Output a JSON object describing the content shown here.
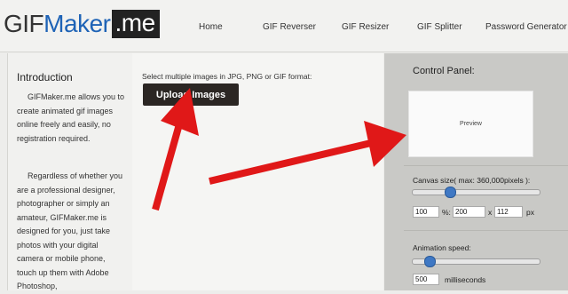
{
  "logo": {
    "part1": "GIF",
    "part2": "Maker",
    "part3": ".me"
  },
  "nav": [
    "Home",
    "GIF Reverser",
    "GIF Resizer",
    "GIF Splitter",
    "Password Generator"
  ],
  "intro": {
    "title": "Introduction",
    "p1": "GIFMaker.me allows you to create animated gif images online freely and easily, no registration required.",
    "p2": "Regardless of whether you are a professional designer, photographer or simply an amateur, GIFMaker.me is designed for you, just take photos with your digital camera or mobile phone, touch up them with Adobe Photoshop,"
  },
  "upload": {
    "hint": "Select multiple images in JPG, PNG or GIF format:",
    "button": "Upload Images"
  },
  "control": {
    "title": "Control Panel:",
    "preview": "Preview",
    "canvas_label": "Canvas size( max: 360,000pixels ):",
    "canvas_slider_fraction": 0.28,
    "percent": "100",
    "percent_unit": "%:",
    "width": "200",
    "x": "x",
    "height": "112",
    "px": "px",
    "speed_label": "Animation speed:",
    "speed_slider_fraction": 0.1,
    "speed": "500",
    "speed_unit": "milliseconds"
  },
  "colors": {
    "arrow": "#e01818",
    "accent": "#1e63b6",
    "button": "#2b2623"
  }
}
